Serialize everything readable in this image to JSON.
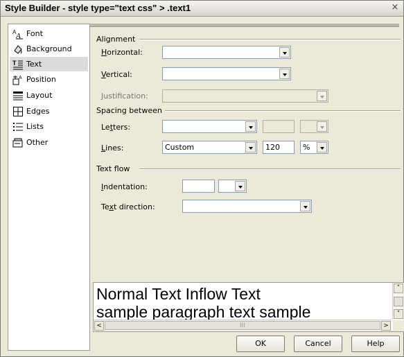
{
  "window": {
    "title": "Style Builder - style type=\"text css\" > .text1",
    "close_glyph": "×"
  },
  "sidebar": {
    "items": [
      {
        "label": "Font",
        "icon": "font-icon",
        "selected": false
      },
      {
        "label": "Background",
        "icon": "background-icon",
        "selected": false
      },
      {
        "label": "Text",
        "icon": "text-icon",
        "selected": true
      },
      {
        "label": "Position",
        "icon": "position-icon",
        "selected": false
      },
      {
        "label": "Layout",
        "icon": "layout-icon",
        "selected": false
      },
      {
        "label": "Edges",
        "icon": "edges-icon",
        "selected": false
      },
      {
        "label": "Lists",
        "icon": "lists-icon",
        "selected": false
      },
      {
        "label": "Other",
        "icon": "other-icon",
        "selected": false
      }
    ]
  },
  "alignment": {
    "group_label": "Alignment",
    "horizontal_label": "Horizontal:",
    "horizontal_value": "",
    "vertical_label": "Vertical:",
    "vertical_value": "",
    "justification_label": "Justification:",
    "justification_value": ""
  },
  "spacing": {
    "group_label": "Spacing between",
    "letters_label": "Letters:",
    "letters_value": "",
    "letters_amount": "",
    "letters_unit": "",
    "lines_label": "Lines:",
    "lines_value": "Custom",
    "lines_amount": "120",
    "lines_unit": "%"
  },
  "textflow": {
    "group_label": "Text flow",
    "indentation_label": "Indentation:",
    "indentation_value": "",
    "indentation_unit": "",
    "direction_label": "Text direction:",
    "direction_value": ""
  },
  "preview": {
    "line1": "Normal Text Inflow Text",
    "line2": "sample paragraph text sample",
    "scroll_up": "˄",
    "scroll_down": "˅",
    "scroll_left": "<",
    "scroll_right": ">",
    "thumb_grip": "III"
  },
  "buttons": {
    "ok": "OK",
    "cancel": "Cancel",
    "help": "Help"
  }
}
